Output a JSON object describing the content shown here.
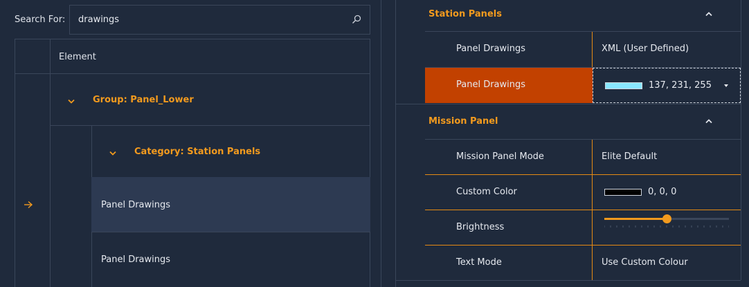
{
  "search": {
    "label": "Search For:",
    "value": "drawings"
  },
  "tree": {
    "column_header": "Element",
    "group_label": "Group: Panel_Lower",
    "category_label": "Category: Station Panels",
    "rows": [
      {
        "label": "Panel Drawings",
        "selected": true
      },
      {
        "label": "Panel Drawings",
        "selected": false
      }
    ]
  },
  "properties": {
    "sections": [
      {
        "title": "Station Panels",
        "rows": [
          {
            "name": "Panel Drawings",
            "value": "XML (User Defined)"
          },
          {
            "name": "Panel Drawings",
            "value": "137, 231, 255",
            "swatch": "#89e7ff",
            "selected": true
          }
        ]
      },
      {
        "title": "Mission Panel",
        "rows": [
          {
            "name": "Mission Panel Mode",
            "value": "Elite Default"
          },
          {
            "name": "Custom Color",
            "value": "0, 0, 0",
            "swatch": "#000000"
          },
          {
            "name": "Brightness",
            "slider_fraction": 0.5
          },
          {
            "name": "Text Mode",
            "value": "Use Custom Colour"
          }
        ]
      }
    ]
  },
  "colors": {
    "accent": "#f29a1e",
    "selected_row": "#c24100",
    "background": "#1f2a3c"
  }
}
